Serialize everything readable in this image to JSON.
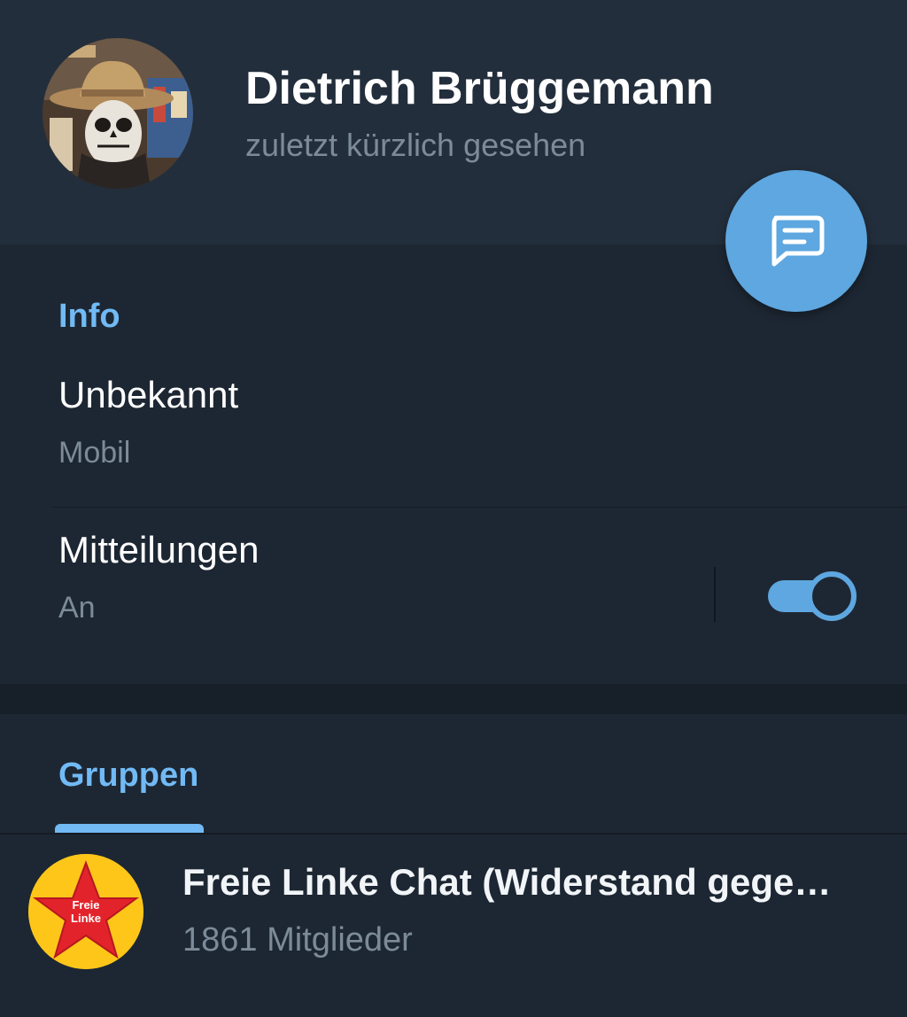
{
  "header": {
    "name": "Dietrich Brüggemann",
    "status": "zuletzt kürzlich gesehen",
    "avatar_icon": "profile-photo",
    "message_icon": "message-icon"
  },
  "info": {
    "title": "Info",
    "phone_value": "Unbekannt",
    "phone_label": "Mobil",
    "notifications_label": "Mitteilungen",
    "notifications_value": "An",
    "notifications_enabled": true
  },
  "groups": {
    "tab_label": "Gruppen",
    "items": [
      {
        "name": "Freie Linke Chat (Widerstand gege…",
        "members": "1861 Mitglieder",
        "avatar_text_line1": "Freie",
        "avatar_text_line2": "Linke"
      }
    ]
  },
  "colors": {
    "background": "#1d2733",
    "header": "#232e3c",
    "accent": "#5ea7e0",
    "section_title": "#71baf5",
    "secondary_text": "#7d8b99",
    "group_avatar_bg": "#ffc61a",
    "star": "#e3232b"
  }
}
